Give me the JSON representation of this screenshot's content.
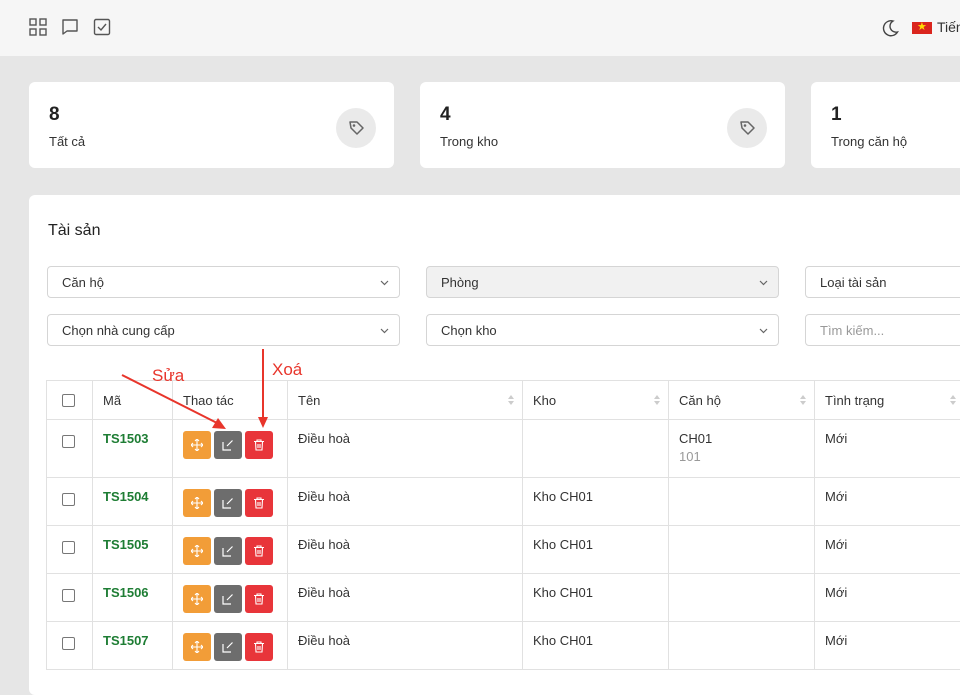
{
  "header": {
    "icons": [
      "grid-icon",
      "chat-icon",
      "checkbox-icon"
    ],
    "theme_icon": "moon-icon",
    "flag_icon": "vietnam-flag-icon",
    "language_label": "Tiến"
  },
  "stats": [
    {
      "count": "8",
      "label": "Tất cả",
      "icon": "tag-icon"
    },
    {
      "count": "4",
      "label": "Trong kho",
      "icon": "tag-icon"
    },
    {
      "count": "1",
      "label": "Trong căn hộ",
      "icon": "tag-icon"
    }
  ],
  "panel": {
    "title": "Tài sản",
    "filters": {
      "apartment": "Căn hộ",
      "room": "Phòng",
      "asset_type": "Loại tài sản",
      "supplier": "Chọn nhà cung cấp",
      "warehouse": "Chọn kho",
      "search_placeholder": "Tìm kiếm..."
    }
  },
  "table": {
    "headers": {
      "code": "Mã",
      "actions": "Thao tác",
      "name": "Tên",
      "warehouse": "Kho",
      "apartment": "Căn hộ",
      "status": "Tình trạng"
    },
    "rows": [
      {
        "code": "TS1503",
        "name": "Điều hoà",
        "warehouse": "",
        "apartment": "CH01",
        "apartment_sub": "101",
        "status": "Mới"
      },
      {
        "code": "TS1504",
        "name": "Điều hoà",
        "warehouse": "Kho CH01",
        "apartment": "",
        "apartment_sub": "",
        "status": "Mới"
      },
      {
        "code": "TS1505",
        "name": "Điều hoà",
        "warehouse": "Kho CH01",
        "apartment": "",
        "apartment_sub": "",
        "status": "Mới"
      },
      {
        "code": "TS1506",
        "name": "Điều hoà",
        "warehouse": "Kho CH01",
        "apartment": "",
        "apartment_sub": "",
        "status": "Mới"
      },
      {
        "code": "TS1507",
        "name": "Điều hoà",
        "warehouse": "Kho CH01",
        "apartment": "",
        "apartment_sub": "",
        "status": "Mới"
      }
    ]
  },
  "annotations": {
    "edit_label": "Sửa",
    "delete_label": "Xoá",
    "color": "#e8352b"
  },
  "colors": {
    "move": "#f29d38",
    "edit": "#6d6d6d",
    "delete": "#e8353a",
    "code": "#1e7d34"
  }
}
